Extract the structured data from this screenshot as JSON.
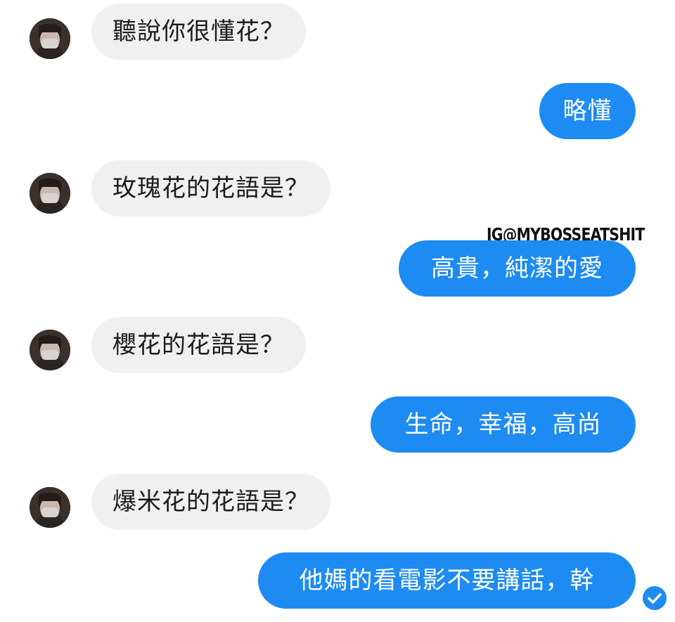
{
  "conversation": {
    "messages": [
      {
        "sender": "contact",
        "text": "聽說你很懂花？"
      },
      {
        "sender": "me",
        "text": "略懂"
      },
      {
        "sender": "contact",
        "text": "玫瑰花的花語是？"
      },
      {
        "sender": "me",
        "text": "高貴，純潔的愛"
      },
      {
        "sender": "contact",
        "text": "櫻花的花語是？"
      },
      {
        "sender": "me",
        "text": "生命，幸福，高尚"
      },
      {
        "sender": "contact",
        "text": "爆米花的花語是？"
      },
      {
        "sender": "me",
        "text": "他媽的看電影不要講話，幹"
      }
    ]
  },
  "watermark": {
    "text": "IG@MYBOSSEATSHIT"
  },
  "colors": {
    "outgoing_bubble": "#1d8bf1",
    "incoming_bubble": "#f0f0f0",
    "seen_check": "#1d8bf1"
  },
  "icons": {
    "avatar": "contact-avatar",
    "seen": "seen-check-icon"
  }
}
